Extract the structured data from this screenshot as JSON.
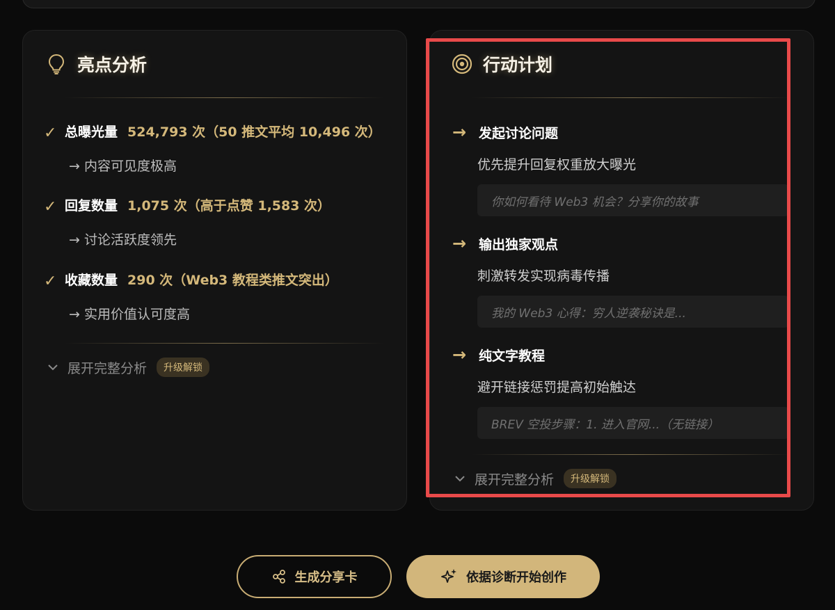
{
  "highlights": {
    "title": "亮点分析",
    "items": [
      {
        "name": "总曝光量",
        "value": "524,793 次（50 推文平均 10,496 次）",
        "note": "→ 内容可见度极高"
      },
      {
        "name": "回复数量",
        "value": "1,075 次（高于点赞 1,583 次）",
        "note": "→ 讨论活跃度领先"
      },
      {
        "name": "收藏数量",
        "value": "290 次（Web3 教程类推文突出）",
        "note": "→ 实用价值认可度高"
      }
    ],
    "expand_label": "展开完整分析",
    "badge": "升级解锁"
  },
  "action_plan": {
    "title": "行动计划",
    "items": [
      {
        "title": "发起讨论问题",
        "desc": "优先提升回复权重放大曝光",
        "example": "你如何看待 Web3 机会？分享你的故事"
      },
      {
        "title": "输出独家观点",
        "desc": "刺激转发实现病毒传播",
        "example": "我的 Web3 心得：穷人逆袭秘诀是..."
      },
      {
        "title": "纯文字教程",
        "desc": "避开链接惩罚提高初始触达",
        "example": "BREV 空投步骤：1. 进入官网...（无链接）"
      }
    ],
    "expand_label": "展开完整分析",
    "badge": "升级解锁"
  },
  "buttons": {
    "share_label": "生成分享卡",
    "create_label": "依据诊断开始创作"
  },
  "colors": {
    "accent_gold": "#d4b87a",
    "highlight_border": "#e84a4a",
    "background": "#0b0b0b"
  },
  "icons": {
    "highlights": "lightbulb-icon",
    "action_plan": "target-icon",
    "check": "check-icon",
    "arrow": "arrow-right-icon",
    "expand": "chevron-down-icon",
    "share": "share-icon",
    "create": "sparkles-icon"
  }
}
